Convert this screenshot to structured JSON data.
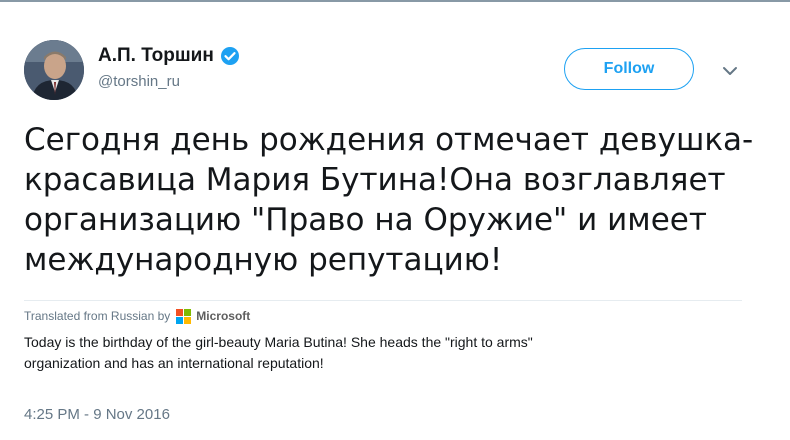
{
  "user": {
    "display_name": "А.П. Торшин",
    "handle": "@torshin_ru"
  },
  "follow_label": "Follow",
  "tweet_text": "Сегодня день рождения отмечает девушка-\nкрасавица Мария Бутина!Она возглавляет\nорганизацию \"Право на Оружие\" и имеет\nмеждународную репутацию!",
  "translation": {
    "prefix": "Translated from Russian by",
    "provider": "Microsoft",
    "text": "Today is the birthday of the girl-beauty Maria Butina! She heads the \"right to arms\"\norganization and has an international reputation!"
  },
  "timestamp": "4:25 PM - 9 Nov 2016",
  "icons": [
    "avatar-photo",
    "verified-badge-icon",
    "chevron-down-icon",
    "microsoft-logo-icon"
  ],
  "colors": {
    "accent": "#1da1f2",
    "secondary_text": "#657786",
    "ms_red": "#f25022",
    "ms_green": "#7fba00",
    "ms_blue": "#00a4ef",
    "ms_yellow": "#ffb900"
  }
}
